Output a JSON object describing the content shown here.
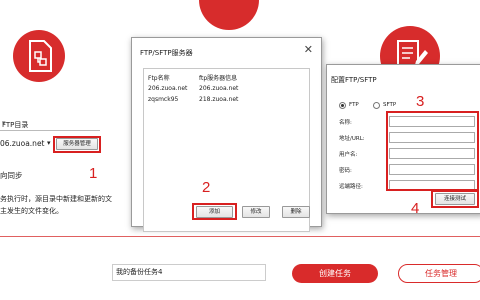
{
  "colors": {
    "accent": "#d72c2c",
    "annotation": "#d82020"
  },
  "left_panel": {
    "dir_label": "FTP目录",
    "server_value": "06.zuoa.net",
    "server_btn": "服务器管理",
    "sync_label": "向同步",
    "desc_line1": "务执行时，源目录中新建和更新的文",
    "desc_line2": "主发生的文件变化。"
  },
  "dialog_server": {
    "title": "FTP/SFTP服务器",
    "columns": [
      "Ftp名称",
      "ftp服务器信息"
    ],
    "rows": [
      [
        "206.zuoa.net",
        "206.zuoa.net"
      ],
      [
        "zqsmck95",
        "218.zuoa.net"
      ]
    ],
    "buttons": {
      "add": "添加",
      "edit": "修改",
      "delete": "删除"
    }
  },
  "dialog_config": {
    "title": "配置FTP/SFTP",
    "protocols": [
      "FTP",
      "SFTP"
    ],
    "fields": [
      "名称:",
      "地址/URL:",
      "用户名:",
      "密码:",
      "远端路径:"
    ],
    "test_button": "连接测试"
  },
  "annotations": [
    "1",
    "2",
    "3",
    "4"
  ],
  "bottom": {
    "task_name": "我的备份任务4",
    "create_btn": "创建任务",
    "manage_btn": "任务管理"
  }
}
